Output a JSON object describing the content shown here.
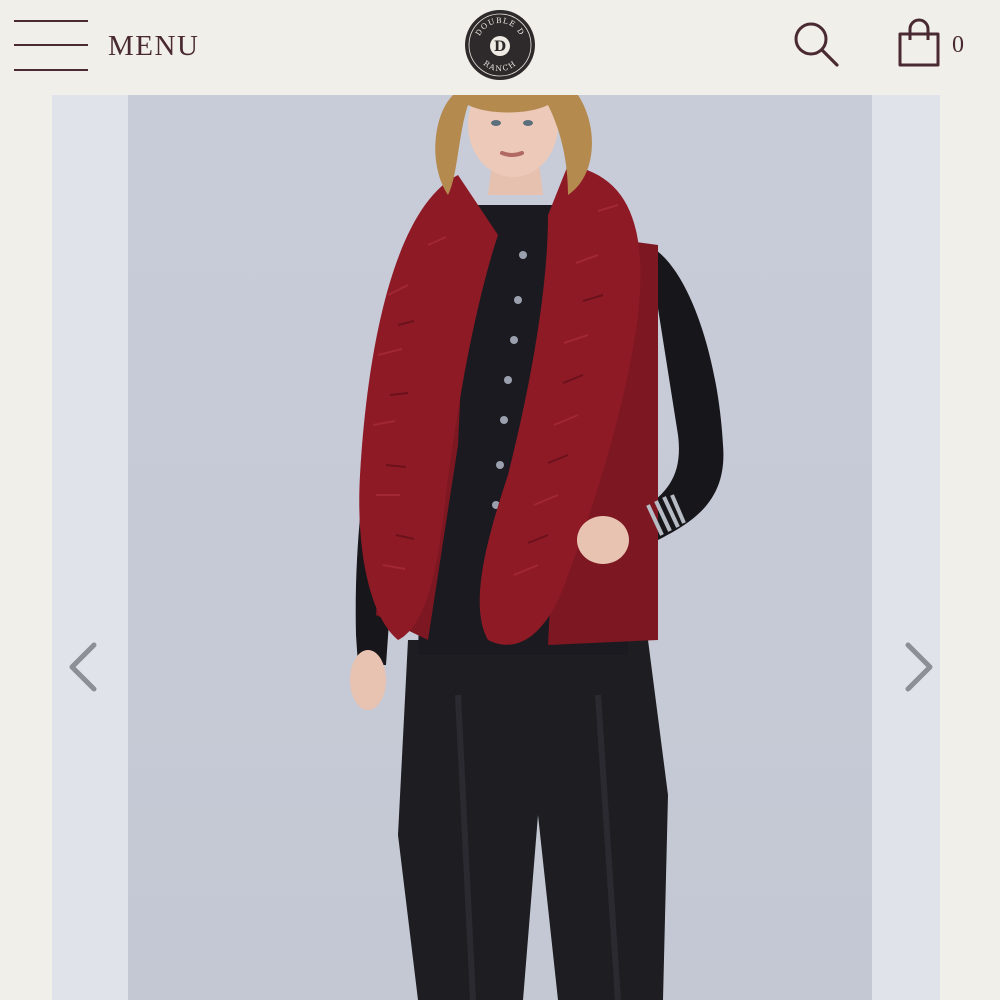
{
  "header": {
    "menu_label": "MENU",
    "logo_text_top": "DOUBLE D",
    "logo_text_bottom": "RANCH",
    "logo_letter": "D",
    "cart_count": "0"
  },
  "gallery": {
    "product_image_alt": "Model wearing burgundy fur-trimmed suede vest over black shirt and black leather pants"
  },
  "colors": {
    "background": "#f1efe9",
    "accent": "#4a2a32",
    "vest": "#8e1a26"
  },
  "icons": [
    "hamburger-icon",
    "search-icon",
    "shopping-bag-icon",
    "chevron-left-icon",
    "chevron-right-icon"
  ]
}
